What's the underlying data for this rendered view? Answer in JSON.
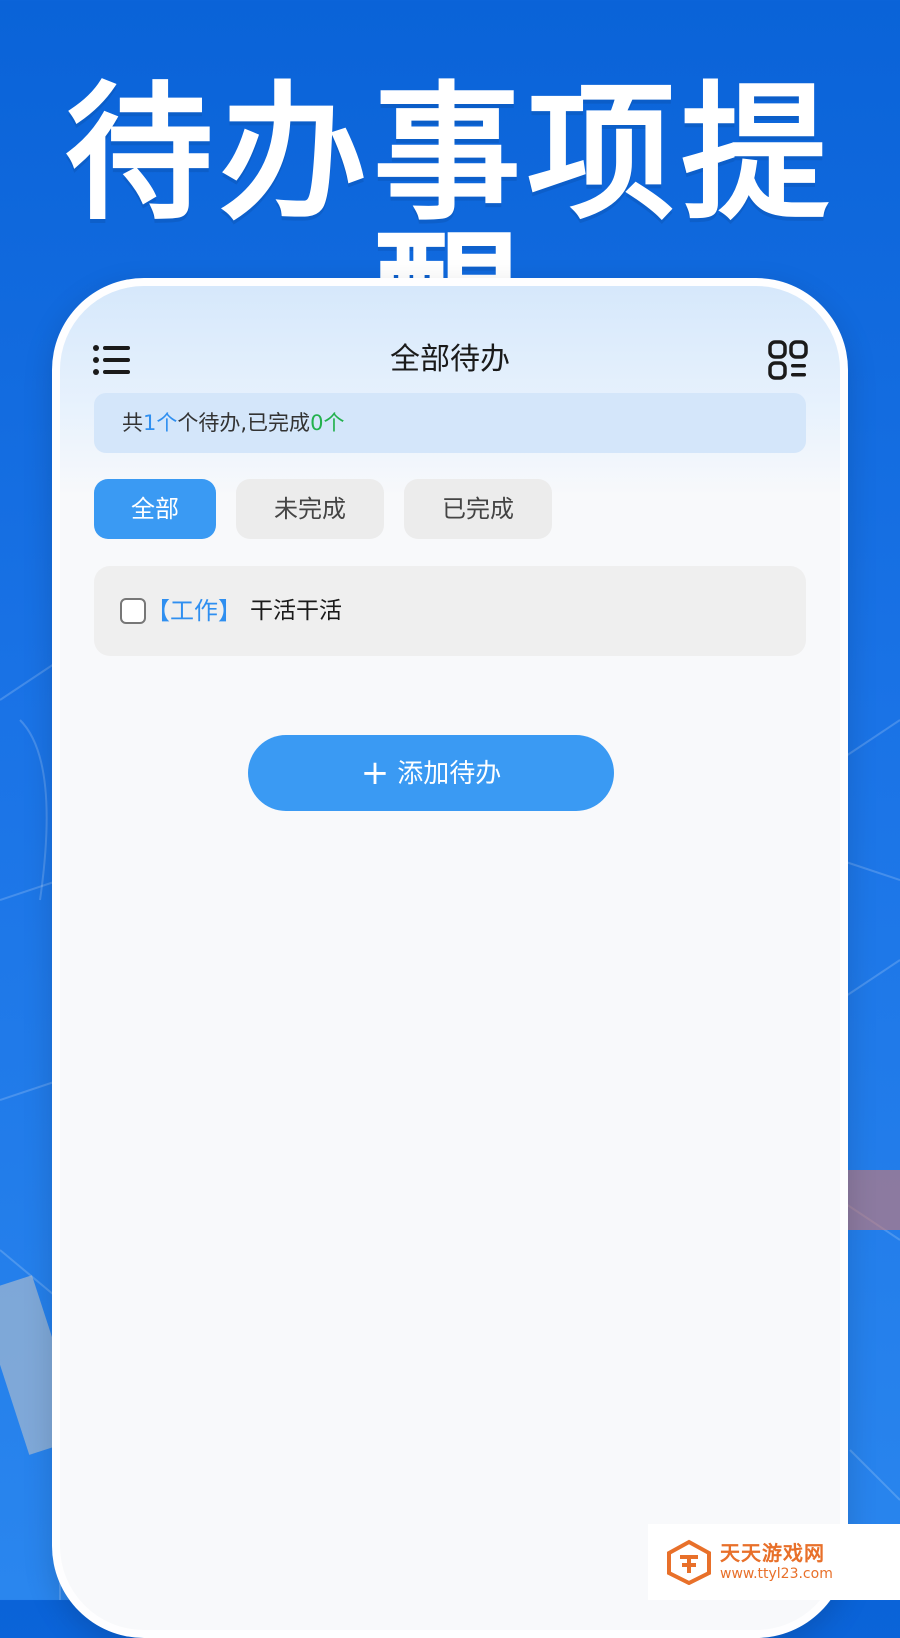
{
  "hero": {
    "title": "待办事项提醒"
  },
  "app": {
    "title": "全部待办",
    "summary": {
      "prefix": "共",
      "total": "1",
      "mid": "个待办,已完成",
      "done": "0",
      "suffix": "个"
    },
    "summary_unit": "个",
    "tabs": [
      {
        "label": "全部",
        "active": true
      },
      {
        "label": "未完成",
        "active": false
      },
      {
        "label": "已完成",
        "active": false
      }
    ],
    "todos": [
      {
        "tag": "【工作】",
        "text": "干活干活",
        "checked": false
      }
    ],
    "add_button": {
      "label": "添加待办",
      "icon": "plus-icon"
    }
  },
  "watermark": {
    "name": "天天游戏网",
    "url": "www.ttyl23.com"
  },
  "colors": {
    "background": "#0a63d8",
    "accent": "#3a9af3",
    "done_green": "#23b14d"
  }
}
